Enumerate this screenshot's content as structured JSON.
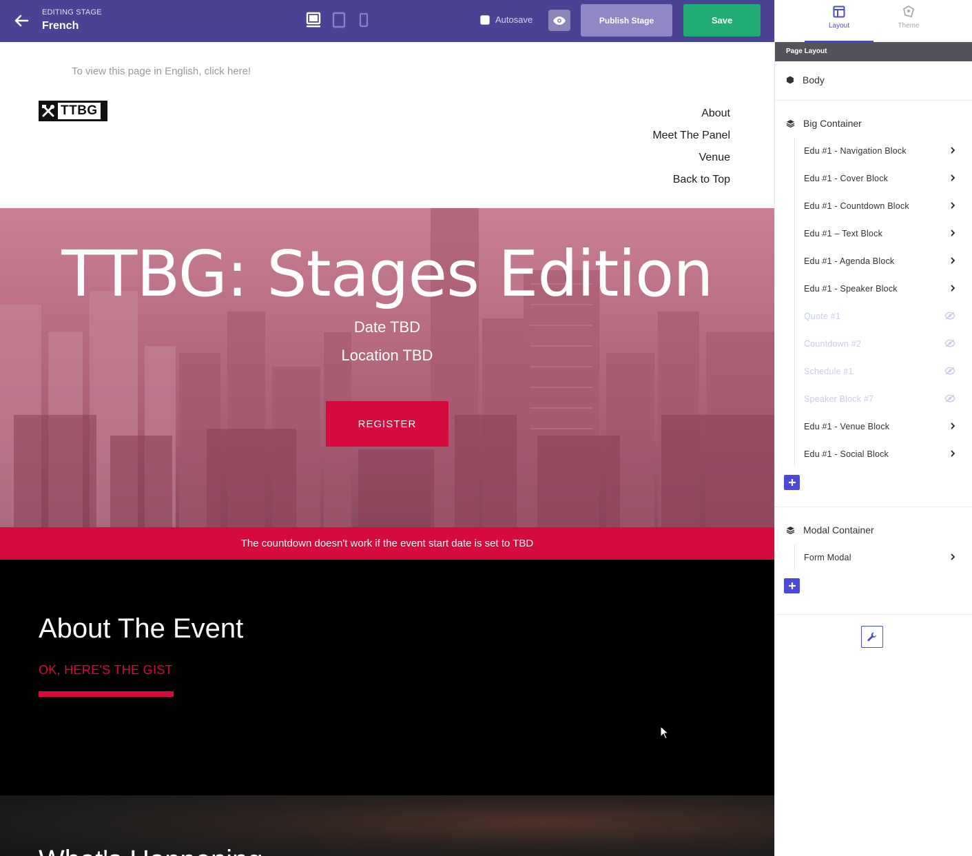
{
  "topbar": {
    "stage_label": "EDITING STAGE",
    "stage_name": "French",
    "autosave_label": "Autosave",
    "publish_label": "Publish Stage",
    "save_label": "Save"
  },
  "page": {
    "lang_link": "To view this page in English, click here!",
    "logo_text": "TTBG",
    "nav": [
      "About",
      "Meet The Panel",
      "Venue",
      "Back to Top"
    ],
    "hero_title": "TTBG: Stages Edition",
    "hero_date": "Date TBD",
    "hero_location": "Location TBD",
    "register_label": "REGISTER",
    "countdown_notice": "The countdown doesn't work if the event start date is set to TBD",
    "about_title": "About The Event",
    "about_subtitle": "OK, HERE'S THE GIST",
    "next_title": "What's Happening"
  },
  "sidebar": {
    "tabs": [
      {
        "label": "Layout",
        "icon": "layout-icon",
        "active": true
      },
      {
        "label": "Theme",
        "icon": "theme-icon",
        "active": false
      }
    ],
    "header": "Page Layout",
    "body_label": "Body",
    "big_container": {
      "label": "Big Container",
      "items": [
        {
          "label": "Edu #1 - Navigation Block",
          "hidden": false
        },
        {
          "label": "Edu #1 - Cover Block",
          "hidden": false
        },
        {
          "label": "Edu #1 - Countdown Block",
          "hidden": false
        },
        {
          "label": "Edu #1 – Text Block",
          "hidden": false
        },
        {
          "label": "Edu #1 - Agenda Block",
          "hidden": false
        },
        {
          "label": "Edu #1 - Speaker Block",
          "hidden": false
        },
        {
          "label": "Quote #1",
          "hidden": true
        },
        {
          "label": "Countdown #2",
          "hidden": true
        },
        {
          "label": "Schedule #1",
          "hidden": true
        },
        {
          "label": "Speaker Block #7",
          "hidden": true
        },
        {
          "label": "Edu #1 - Venue Block",
          "hidden": false
        },
        {
          "label": "Edu #1 - Social Block",
          "hidden": false
        }
      ]
    },
    "modal_container": {
      "label": "Modal Container",
      "items": [
        {
          "label": "Form Modal",
          "hidden": false
        }
      ]
    }
  },
  "colors": {
    "topbar": "#4c4294",
    "accent": "#d50b3d",
    "save": "#1fad75",
    "publish": "#8f88c4",
    "sidebar_accent": "#4a4ad6"
  }
}
